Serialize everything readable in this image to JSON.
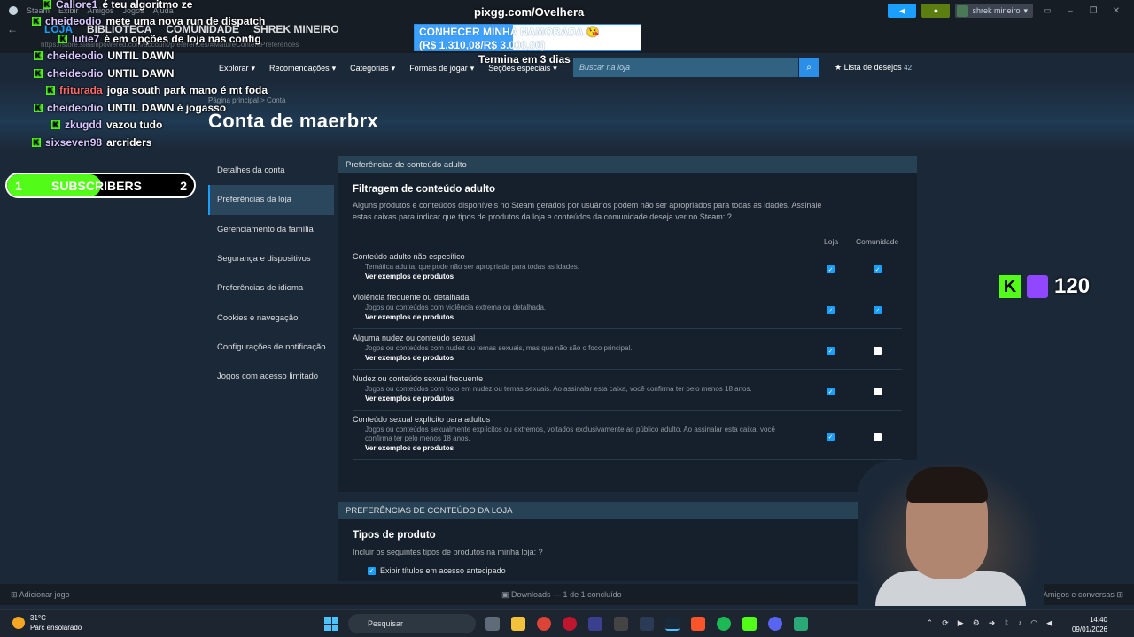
{
  "titlebar": {
    "menu": [
      "Steam",
      "Exibir",
      "Amigos",
      "Jogos",
      "Ajuda"
    ],
    "user": "shrek mineiro"
  },
  "nav": {
    "tabs": [
      "LOJA",
      "BIBLIOTECA",
      "COMUNIDADE",
      "SHREK MINEIRO"
    ],
    "url": "https://store.steampowered.com/account/preferences/#MatureContentPreferences"
  },
  "store_nav": {
    "items": [
      "Explorar",
      "Recomendações",
      "Categorias",
      "Formas de jogar",
      "Seções especiais"
    ],
    "search_placeholder": "Buscar na loja",
    "wishlist_label": "Lista de desejos",
    "wishlist_count": "42"
  },
  "breadcrumb": "Página principal > Conta",
  "page_title": "Conta de maerbrx",
  "sidebar": {
    "items": [
      {
        "label": "Detalhes da conta"
      },
      {
        "label": "Preferências da loja"
      },
      {
        "label": "Gerenciamento da família"
      },
      {
        "label": "Segurança e dispositivos"
      },
      {
        "label": "Preferências de idioma"
      },
      {
        "label": "Cookies e navegação"
      },
      {
        "label": "Configurações de notificação"
      },
      {
        "label": "Jogos com acesso limitado"
      }
    ]
  },
  "adult": {
    "header": "Preferências de conteúdo adulto",
    "title": "Filtragem de conteúdo adulto",
    "desc": "Alguns produtos e conteúdos disponíveis no Steam gerados por usuários podem não ser apropriados para todas as idades. Assinale estas caixas para indicar que tipos de produtos da loja e conteúdos da comunidade deseja ver no Steam: ?",
    "col_store": "Loja",
    "col_community": "Comunidade",
    "link": "Ver exemplos de produtos",
    "rows": [
      {
        "title": "Conteúdo adulto não específico",
        "desc": "Temática adulta, que pode não ser apropriada para todas as idades.",
        "store": true,
        "community": true
      },
      {
        "title": "Violência frequente ou detalhada",
        "desc": "Jogos ou conteúdos com violência extrema ou detalhada.",
        "store": true,
        "community": true
      },
      {
        "title": "Alguma nudez ou conteúdo sexual",
        "desc": "Jogos ou conteúdos com nudez ou temas sexuais, mas que não são o foco principal.",
        "store": true,
        "community": false
      },
      {
        "title": "Nudez ou conteúdo sexual frequente",
        "desc": "Jogos ou conteúdos com foco em nudez ou temas sexuais. Ao assinalar esta caixa, você confirma ter pelo menos 18 anos.",
        "store": true,
        "community": false
      },
      {
        "title": "Conteúdo sexual explícito para adultos",
        "desc": "Jogos ou conteúdos sexualmente explícitos ou extremos, voltados exclusivamente ao público adulto. Ao assinalar esta caixa, você confirma ter pelo menos 18 anos.",
        "store": true,
        "community": false
      }
    ]
  },
  "store_content": {
    "header": "PREFERÊNCIAS DE CONTEÚDO DA LOJA",
    "title": "Tipos de produto",
    "desc": "Incluir os seguintes tipos de produtos na minha loja: ?",
    "option": "Exibir títulos em acesso antecipado"
  },
  "bottombar": {
    "add_game": "Adicionar jogo",
    "downloads": "Downloads — 1 de 1 concluído",
    "friends": "Amigos e conversas"
  },
  "taskbar": {
    "temp": "31°C",
    "weather": "Parc ensolarado",
    "search": "Pesquisar",
    "time": "14:40",
    "date": "09/01/2026"
  },
  "overlay": {
    "chat": [
      {
        "user": "Callore1",
        "msg": "é teu algoritmo ze"
      },
      {
        "user": "cheideodio",
        "msg": "mete uma nova run de dispatch"
      },
      {
        "user": "lutie7",
        "msg": "é em opções de loja nas config"
      },
      {
        "user": "cheideodio",
        "msg": "UNTIL DAWN"
      },
      {
        "user": "cheideodio",
        "msg": "UNTIL DAWN"
      },
      {
        "user": "friturada",
        "msg": "joga south park mano é mt foda"
      },
      {
        "user": "cheideodio",
        "msg": "UNTIL DAWN é jogasso"
      },
      {
        "user": "zkugdd",
        "msg": "vazou tudo"
      },
      {
        "user": "sixseven98",
        "msg": "arcriders"
      }
    ],
    "subs_current": "1",
    "subs_label": "SUBSCRIBERS",
    "subs_goal": "2",
    "subs_progress": 0.5,
    "pix": "pixgg.com/Ovelhera",
    "goal_line1": "CONHECER MINHA NAMORADA 😘",
    "goal_line2": "(R$ 1.310,08/R$ 3.000,00)",
    "goal_progress": 0.437,
    "ends": "Termina em 3 dias",
    "viewers": "120"
  },
  "colors": {
    "accent": "#1a9fff",
    "kick": "#53fc18",
    "twitch": "#9146ff"
  }
}
